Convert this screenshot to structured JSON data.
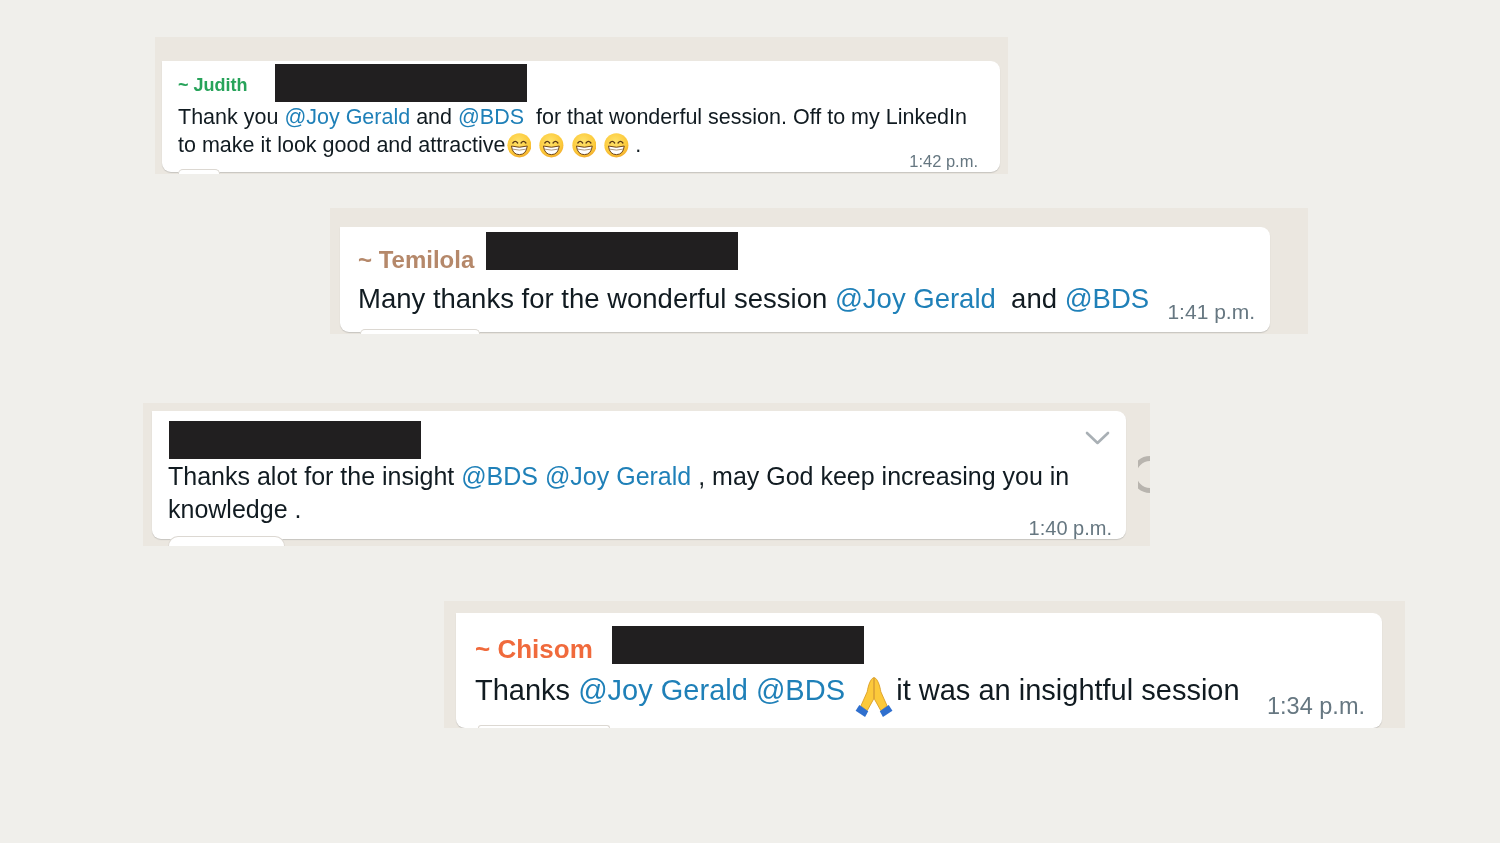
{
  "messages": [
    {
      "sender": "~ Judith",
      "color": "#27a35a",
      "redacted": true,
      "hovered": false,
      "reactions_shown": true,
      "body": [
        {
          "kind": "text",
          "text": "Thank you "
        },
        {
          "kind": "mention",
          "text": "@Joy Gerald"
        },
        {
          "kind": "text",
          "text": " and "
        },
        {
          "kind": "mention",
          "text": "@BDS"
        },
        {
          "kind": "text",
          "text": "  for that wonderful session. Off to my LinkedIn to make it look good and attractive"
        },
        {
          "kind": "grin"
        },
        {
          "kind": "grin"
        },
        {
          "kind": "grin"
        },
        {
          "kind": "grin"
        },
        {
          "kind": "text",
          "text": "."
        }
      ],
      "time": "1:42 p.m."
    },
    {
      "sender": "~ Temilola",
      "color": "#b5886a",
      "redacted": true,
      "hovered": false,
      "reactions_shown": true,
      "body": [
        {
          "kind": "text",
          "text": "Many thanks for the wonderful session "
        },
        {
          "kind": "mention",
          "text": "@Joy Gerald"
        },
        {
          "kind": "text",
          "text": "  and "
        },
        {
          "kind": "mention",
          "text": "@BDS"
        }
      ],
      "time": "1:41 p.m."
    },
    {
      "redacted": true,
      "hovered": true,
      "reactions_shown": true,
      "body": [
        {
          "kind": "text",
          "text": "Thanks alot for the insight "
        },
        {
          "kind": "mention",
          "text": "@BDS "
        },
        {
          "kind": "mention",
          "text": "@Joy Gerald"
        },
        {
          "kind": "text",
          "text": " , may God keep increasing you in knowledge ."
        }
      ],
      "time": "1:40 p.m."
    },
    {
      "sender": "~ Chisom",
      "color": "#f06a3c",
      "redacted": true,
      "hovered": false,
      "reactions_shown": true,
      "body": [
        {
          "kind": "text",
          "text": "Thanks "
        },
        {
          "kind": "mention",
          "text": "@Joy Gerald "
        },
        {
          "kind": "mention",
          "text": "@BDS "
        },
        {
          "kind": "pray"
        },
        {
          "kind": "text",
          "text": "it was an insightful session"
        }
      ],
      "time": "1:34 p.m."
    }
  ]
}
